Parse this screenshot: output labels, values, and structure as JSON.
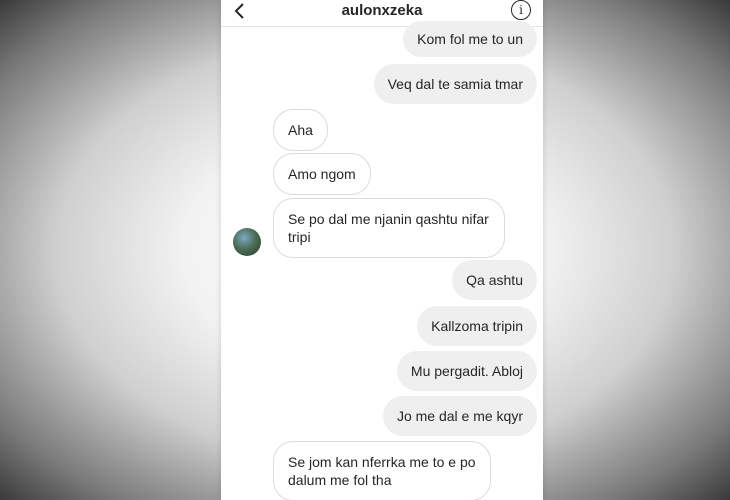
{
  "header": {
    "username": "aulonxzeka",
    "info_glyph": "i"
  },
  "messages": [
    {
      "side": "sent",
      "text": "Kom fol me to un"
    },
    {
      "side": "sent",
      "text": "Veq dal te samia tmar"
    },
    {
      "side": "received",
      "text": "Aha"
    },
    {
      "side": "received",
      "text": "Amo ngom"
    },
    {
      "side": "received",
      "text": "Se po dal me njanin qashtu nifar tripi"
    },
    {
      "side": "sent",
      "text": "Qa ashtu"
    },
    {
      "side": "sent",
      "text": "Kallzoma tripin"
    },
    {
      "side": "sent",
      "text": "Mu pergadit. Abloj"
    },
    {
      "side": "sent",
      "text": "Jo me dal e me kqyr"
    },
    {
      "side": "received",
      "text": "Se jom kan nferrka me to e po dalum me fol tha"
    }
  ],
  "colors": {
    "sent_bubble": "#efefef",
    "received_border": "#dbdbdb",
    "text": "#262626"
  }
}
